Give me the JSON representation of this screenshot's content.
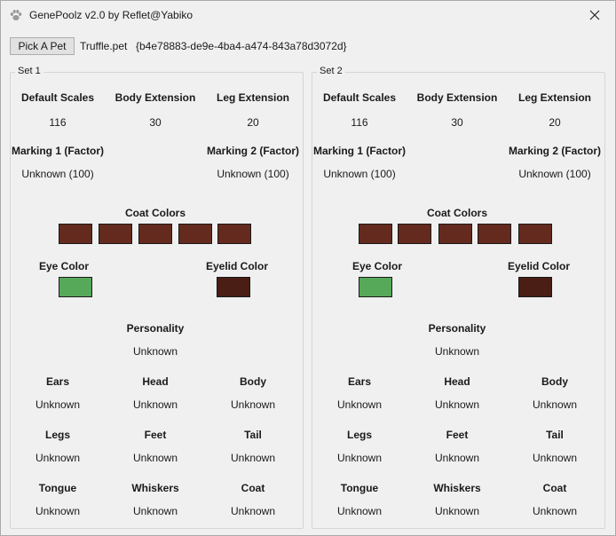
{
  "window": {
    "title": "GenePoolz v2.0 by Reflet@Yabiko"
  },
  "toolbar": {
    "pick_button": "Pick A Pet",
    "file_name": "Truffle.pet",
    "pet_guid": "{b4e78883-de9e-4ba4-a474-843a78d3072d}"
  },
  "labels": {
    "default_scales": "Default Scales",
    "body_extension": "Body Extension",
    "leg_extension": "Leg Extension",
    "marking1": "Marking 1 (Factor)",
    "marking2": "Marking 2 (Factor)",
    "coat_colors": "Coat Colors",
    "eye_color": "Eye Color",
    "eyelid_color": "Eyelid Color",
    "personality": "Personality",
    "ears": "Ears",
    "head": "Head",
    "body": "Body",
    "legs": "Legs",
    "feet": "Feet",
    "tail": "Tail",
    "tongue": "Tongue",
    "whiskers": "Whiskers",
    "coat": "Coat"
  },
  "sets": [
    {
      "label": "Set 1",
      "default_scales": "116",
      "body_extension": "30",
      "leg_extension": "20",
      "marking1": "Unknown (100)",
      "marking2": "Unknown (100)",
      "coat_colors": [
        "#652a1e",
        "#652a1e",
        "#652a1e",
        "#652a1e",
        "#652a1e"
      ],
      "eye_color": "#57a95a",
      "eyelid_color": "#4a1e14",
      "personality": "Unknown",
      "ears": "Unknown",
      "head": "Unknown",
      "body": "Unknown",
      "legs": "Unknown",
      "feet": "Unknown",
      "tail": "Unknown",
      "tongue": "Unknown",
      "whiskers": "Unknown",
      "coat": "Unknown"
    },
    {
      "label": "Set 2",
      "default_scales": "116",
      "body_extension": "30",
      "leg_extension": "20",
      "marking1": "Unknown (100)",
      "marking2": "Unknown (100)",
      "coat_colors": [
        "#652a1e",
        "#652a1e",
        "#652a1e",
        "#652a1e",
        "#652a1e"
      ],
      "eye_color": "#57a95a",
      "eyelid_color": "#4a1e14",
      "personality": "Unknown",
      "ears": "Unknown",
      "head": "Unknown",
      "body": "Unknown",
      "legs": "Unknown",
      "feet": "Unknown",
      "tail": "Unknown",
      "tongue": "Unknown",
      "whiskers": "Unknown",
      "coat": "Unknown"
    }
  ]
}
